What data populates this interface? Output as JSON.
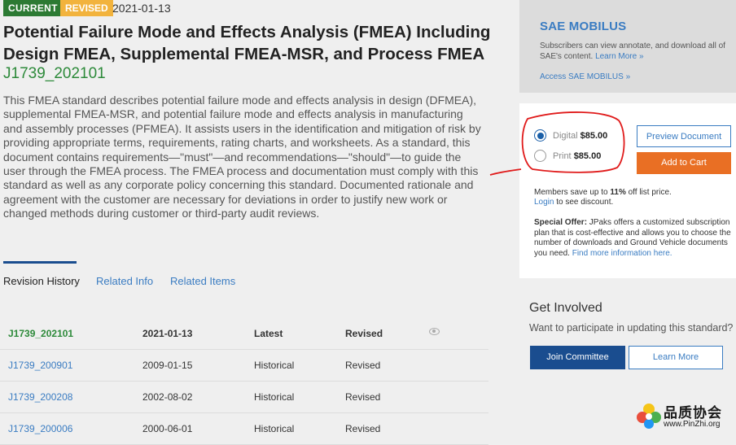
{
  "header": {
    "badge_current": "CURRENT",
    "badge_revised": "REVISED",
    "date": "2021-01-13",
    "title": "Potential Failure Mode and Effects Analysis (FMEA) Including Design FMEA, Supplemental FMEA-MSR, and Process FMEA",
    "doc_id": "J1739_202101",
    "description": "This FMEA standard describes potential failure mode and effects analysis in design (DFMEA), supplemental FMEA-MSR, and potential failure mode and effects analysis in manufacturing and assembly processes (PFMEA). It assists users in the identification and mitigation of risk by providing appropriate terms, requirements, rating charts, and worksheets. As a standard, this document contains requirements—\"must\"—and recommendations—\"should\"—to guide the user through the FMEA process. The FMEA process and documentation must comply with this standard as well as any corporate policy concerning this standard. Documented rationale and agreement with the customer are necessary for deviations in order to justify new work or changed methods during customer or third-party audit reviews."
  },
  "tabs": [
    {
      "label": "Revision History"
    },
    {
      "label": "Related Info"
    },
    {
      "label": "Related Items"
    }
  ],
  "revisions": [
    {
      "id": "J1739_202101",
      "date": "2021-01-13",
      "status": "Latest",
      "type": "Revised"
    },
    {
      "id": "J1739_200901",
      "date": "2009-01-15",
      "status": "Historical",
      "type": "Revised"
    },
    {
      "id": "J1739_200208",
      "date": "2002-08-02",
      "status": "Historical",
      "type": "Revised"
    },
    {
      "id": "J1739_200006",
      "date": "2000-06-01",
      "status": "Historical",
      "type": "Revised"
    }
  ],
  "mobilus": {
    "title": "SAE MOBILUS",
    "text": "Subscribers can view annotate, and download all of SAE's content.",
    "learn_more": "Learn More »",
    "access": "Access SAE MOBILUS »"
  },
  "purchase": {
    "digital_label": "Digital",
    "digital_price": "$85.00",
    "print_label": "Print",
    "print_price": "$85.00",
    "selected": "digital",
    "preview_button": "Preview Document",
    "cart_button": "Add to Cart",
    "members_pre": "Members save up to ",
    "members_pct": "11%",
    "members_post": " off list price.",
    "login_link": "Login",
    "login_post": " to see discount.",
    "offer_label": "Special Offer:",
    "offer_text": " JPaks offers a customized subscription plan that is cost-effective and allows you to choose the number of downloads and Ground Vehicle documents you need. ",
    "offer_link": "Find more information here."
  },
  "get_involved": {
    "title": "Get Involved",
    "text": "Want to participate in updating this standard?",
    "join_button": "Join Committee",
    "learn_button": "Learn More"
  },
  "watermark": {
    "line1": "品质协会",
    "line2": "www.PinZhi.org"
  },
  "colors": {
    "accent_blue": "#3a7cc2",
    "navy": "#1a4d8f",
    "green": "#2d8a3a",
    "orange": "#e96f24",
    "annotation_red": "#e01b1b"
  }
}
